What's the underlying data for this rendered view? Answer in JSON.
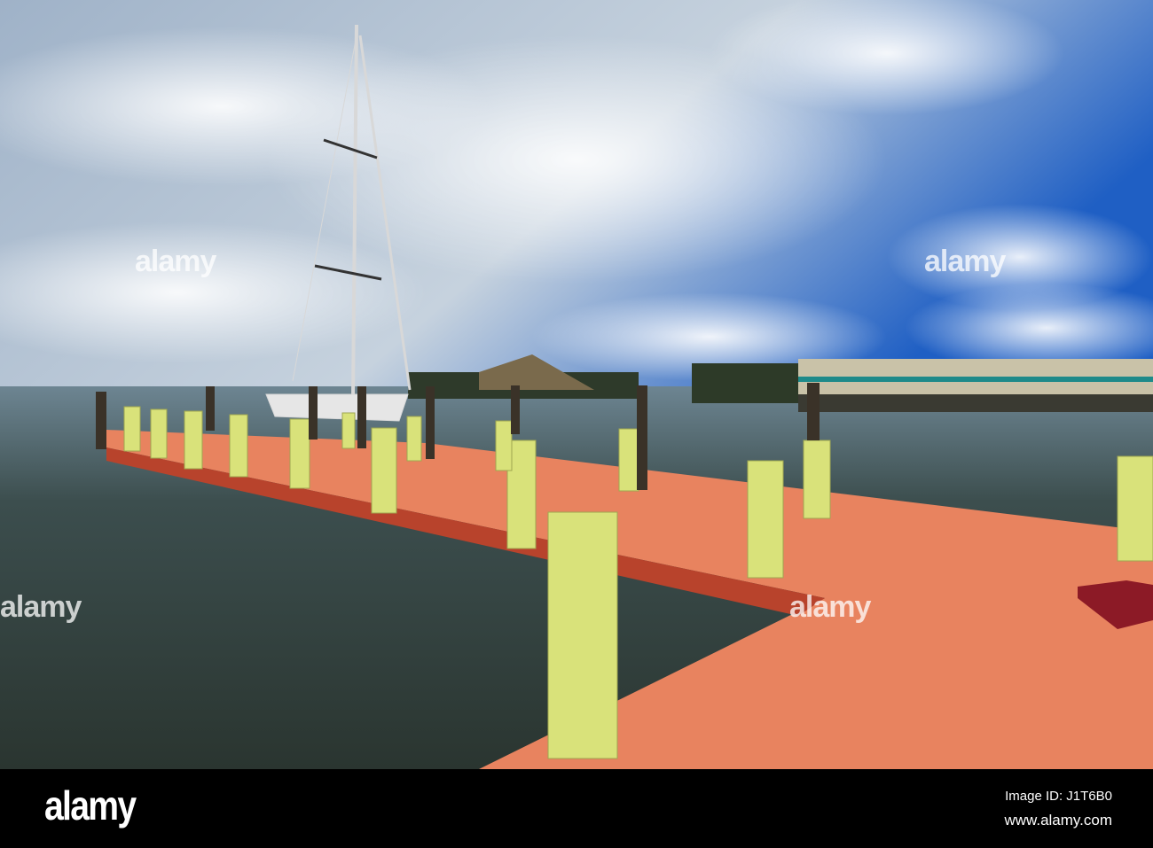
{
  "watermark": {
    "brand": "alamy"
  },
  "footer": {
    "logo": "alamy",
    "image_id": "Image ID: J1T6B0",
    "website": "www.alamy.com"
  },
  "colors": {
    "dock": "#e8835f",
    "posts": "#d9e27a",
    "water": "#3c4a45",
    "sky": "#2d66c0"
  }
}
